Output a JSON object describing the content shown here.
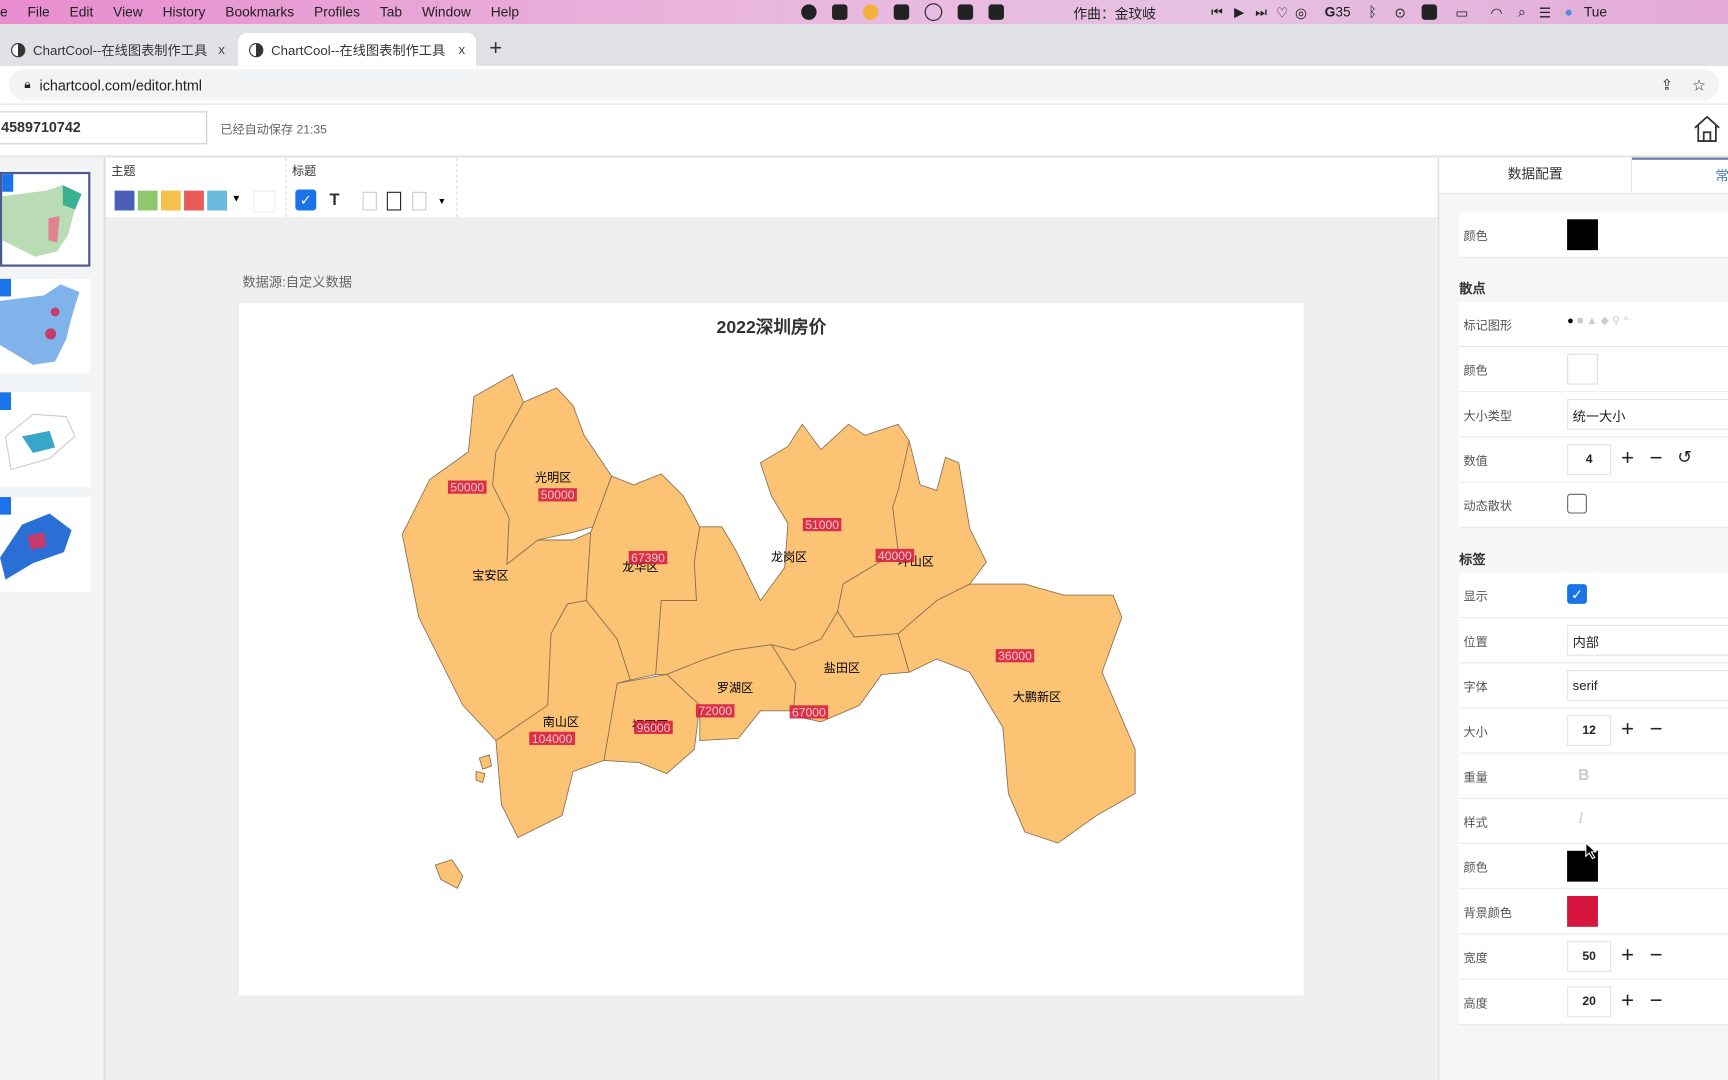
{
  "menubar": {
    "items": [
      "e",
      "File",
      "Edit",
      "View",
      "History",
      "Bookmarks",
      "Profiles",
      "Tab",
      "Window",
      "Help"
    ],
    "now_playing": "作曲：金玟岐",
    "battery_count": "35",
    "clock": "Tue"
  },
  "browser": {
    "tabs": [
      {
        "title": "ChartCool--在线图表制作工具",
        "close": "x"
      },
      {
        "title": "ChartCool--在线图表制作工具",
        "close": "x"
      }
    ],
    "new_tab": "+",
    "url": "ichartcool.com/editor.html"
  },
  "app": {
    "filename": "4589710742",
    "saved_status": "已经自动保存 21:35"
  },
  "toolbar": {
    "theme_label": "主题",
    "theme_colors": [
      "#4c5fb6",
      "#8ec86a",
      "#f6c04d",
      "#e95b5b",
      "#6bb9dc"
    ],
    "title_label": "标题",
    "title_enabled": true,
    "text_icon": "T"
  },
  "chart": {
    "datasource": "数据源:自定义数据",
    "title": "2022深圳房价"
  },
  "chart_data": {
    "type": "map",
    "title": "2022深圳房价",
    "region": "深圳",
    "fill_color": "#fdc374",
    "label_bg_color": "#d6163f",
    "regions": [
      {
        "name": "宝安区",
        "value": 50000
      },
      {
        "name": "光明区",
        "value": 50000
      },
      {
        "name": "龙华区",
        "value": 67390
      },
      {
        "name": "龙岗区",
        "value": 51000
      },
      {
        "name": "坪山区",
        "value": 40000
      },
      {
        "name": "盐田区",
        "value": 67000
      },
      {
        "name": "罗湖区",
        "value": 72000
      },
      {
        "name": "福田区",
        "value": 96000
      },
      {
        "name": "南山区",
        "value": 104000
      },
      {
        "name": "大鹏新区",
        "value": 36000
      }
    ]
  },
  "panel": {
    "tabs": [
      "数据配置",
      "常"
    ],
    "top_color": {
      "label": "颜色",
      "value": "#000000"
    },
    "scatter": {
      "title": "散点",
      "marker_label": "标记图形",
      "color_label": "颜色",
      "color": "#ffffff",
      "size_type_label": "大小类型",
      "size_type": "统一大小",
      "value_label": "数值",
      "value": "4",
      "dynamic_label": "动态散状",
      "dynamic": false
    },
    "label": {
      "title": "标签",
      "show_label": "显示",
      "show": true,
      "position_label": "位置",
      "position": "内部",
      "font_label": "字体",
      "font": "serif",
      "size_label": "大小",
      "size": "12",
      "weight_label": "重量",
      "weight_icon": "B",
      "style_label": "样式",
      "style_icon": "I",
      "color_label": "颜色",
      "color": "#000000",
      "bg_label": "背景颜色",
      "bg": "#d6163f",
      "width_label": "宽度",
      "width": "50",
      "height_label": "高度",
      "height": "20"
    }
  }
}
